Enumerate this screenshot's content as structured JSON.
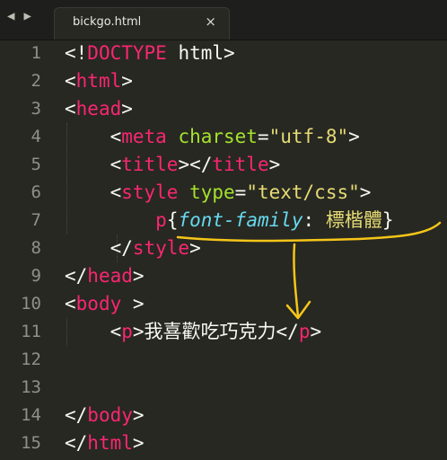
{
  "nav": {
    "back": "◀",
    "forward": "▶"
  },
  "tab": {
    "label": "bickgo.html",
    "close": "×"
  },
  "lines": [
    {
      "n": "1",
      "parts": [
        [
          "",
          "<!"
        ],
        [
          "t",
          "DOCTYPE"
        ],
        [
          "",
          " html>"
        ]
      ]
    },
    {
      "n": "2",
      "parts": [
        [
          "",
          "<"
        ],
        [
          "t",
          "html"
        ],
        [
          "",
          ">"
        ]
      ]
    },
    {
      "n": "3",
      "parts": [
        [
          "",
          "<"
        ],
        [
          "t",
          "head"
        ],
        [
          "",
          ">"
        ]
      ]
    },
    {
      "n": "4",
      "parts": [
        [
          "",
          "    <"
        ],
        [
          "t",
          "meta"
        ],
        [
          "",
          " "
        ],
        [
          "a",
          "charset"
        ],
        [
          "",
          "="
        ],
        [
          "s",
          "\"utf-8\""
        ],
        [
          "",
          ">"
        ]
      ]
    },
    {
      "n": "5",
      "parts": [
        [
          "",
          "    <"
        ],
        [
          "t",
          "title"
        ],
        [
          "",
          "></"
        ],
        [
          "t",
          "title"
        ],
        [
          "",
          ">"
        ]
      ]
    },
    {
      "n": "6",
      "parts": [
        [
          "",
          "    <"
        ],
        [
          "t",
          "style"
        ],
        [
          "",
          " "
        ],
        [
          "a",
          "type"
        ],
        [
          "",
          "="
        ],
        [
          "s",
          "\"text/css\""
        ],
        [
          "",
          ">"
        ]
      ]
    },
    {
      "n": "7",
      "parts": [
        [
          "",
          "        "
        ],
        [
          "t",
          "p"
        ],
        [
          "",
          "{"
        ],
        [
          "p",
          "font-family"
        ],
        [
          "",
          ": "
        ],
        [
          "s",
          "標楷體"
        ],
        [
          "",
          "}"
        ]
      ]
    },
    {
      "n": "8",
      "parts": [
        [
          "",
          "    </"
        ],
        [
          "t",
          "style"
        ],
        [
          "",
          ">"
        ]
      ]
    },
    {
      "n": "9",
      "parts": [
        [
          "",
          "</"
        ],
        [
          "t",
          "head"
        ],
        [
          "",
          ">"
        ]
      ]
    },
    {
      "n": "10",
      "parts": [
        [
          "",
          "<"
        ],
        [
          "t",
          "body"
        ],
        [
          "",
          " >"
        ]
      ]
    },
    {
      "n": "11",
      "parts": [
        [
          "",
          "    <"
        ],
        [
          "t",
          "p"
        ],
        [
          "",
          ">我喜歡吃巧克力</"
        ],
        [
          "t",
          "p"
        ],
        [
          "",
          ">"
        ]
      ]
    },
    {
      "n": "12",
      "parts": []
    },
    {
      "n": "13",
      "parts": []
    },
    {
      "n": "14",
      "parts": [
        [
          "",
          "</"
        ],
        [
          "t",
          "body"
        ],
        [
          "",
          ">"
        ]
      ]
    },
    {
      "n": "15",
      "parts": [
        [
          "",
          "</"
        ],
        [
          "t",
          "html"
        ],
        [
          "",
          ">"
        ]
      ]
    }
  ],
  "colors": {
    "background": "#272822",
    "tag": "#f92672",
    "attr": "#a6e22e",
    "string": "#e6db74",
    "property": "#66d9ef",
    "annotation": "#f5c518"
  }
}
